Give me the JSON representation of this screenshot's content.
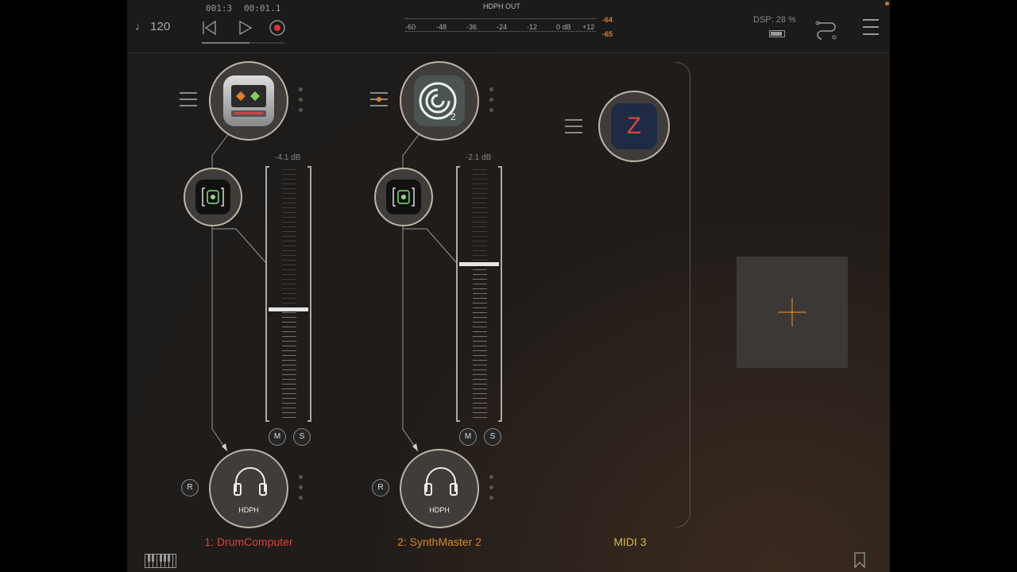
{
  "header": {
    "tempo": "♩ 120",
    "bar_position": "001:3",
    "time": "00:01.1",
    "meter_title": "HDPH OUT",
    "meter_scale": [
      "-60",
      "-48",
      "-36",
      "-24",
      "-12",
      "0 dB",
      "+12"
    ],
    "peak_left": "-64",
    "peak_right": "-65",
    "dsp": "DSP: 28 %"
  },
  "channels": [
    {
      "name": "1: DrumComputer",
      "name_color": "#d2473a",
      "db": "-4.1 dB",
      "fader_level": 0.44,
      "mute": "M",
      "solo": "S",
      "record": "R",
      "output": "HDPH"
    },
    {
      "name": "2: SynthMaster 2",
      "name_color": "#d6882a",
      "db": "-2.1 dB",
      "fader_level": 0.62,
      "mute": "M",
      "solo": "S",
      "record": "R",
      "output": "HDPH"
    },
    {
      "name": "MIDI 3",
      "name_color": "#d7b845",
      "icon_letter": "Z"
    }
  ],
  "colors": {
    "accent_orange": "#e0802a",
    "background": "#1c1c1c"
  },
  "icons": [
    "note-icon",
    "rewind-icon",
    "play-icon",
    "record-icon",
    "routing-icon",
    "menu-icon",
    "piano-keyboard-icon",
    "bookmark-icon",
    "plus-icon"
  ]
}
